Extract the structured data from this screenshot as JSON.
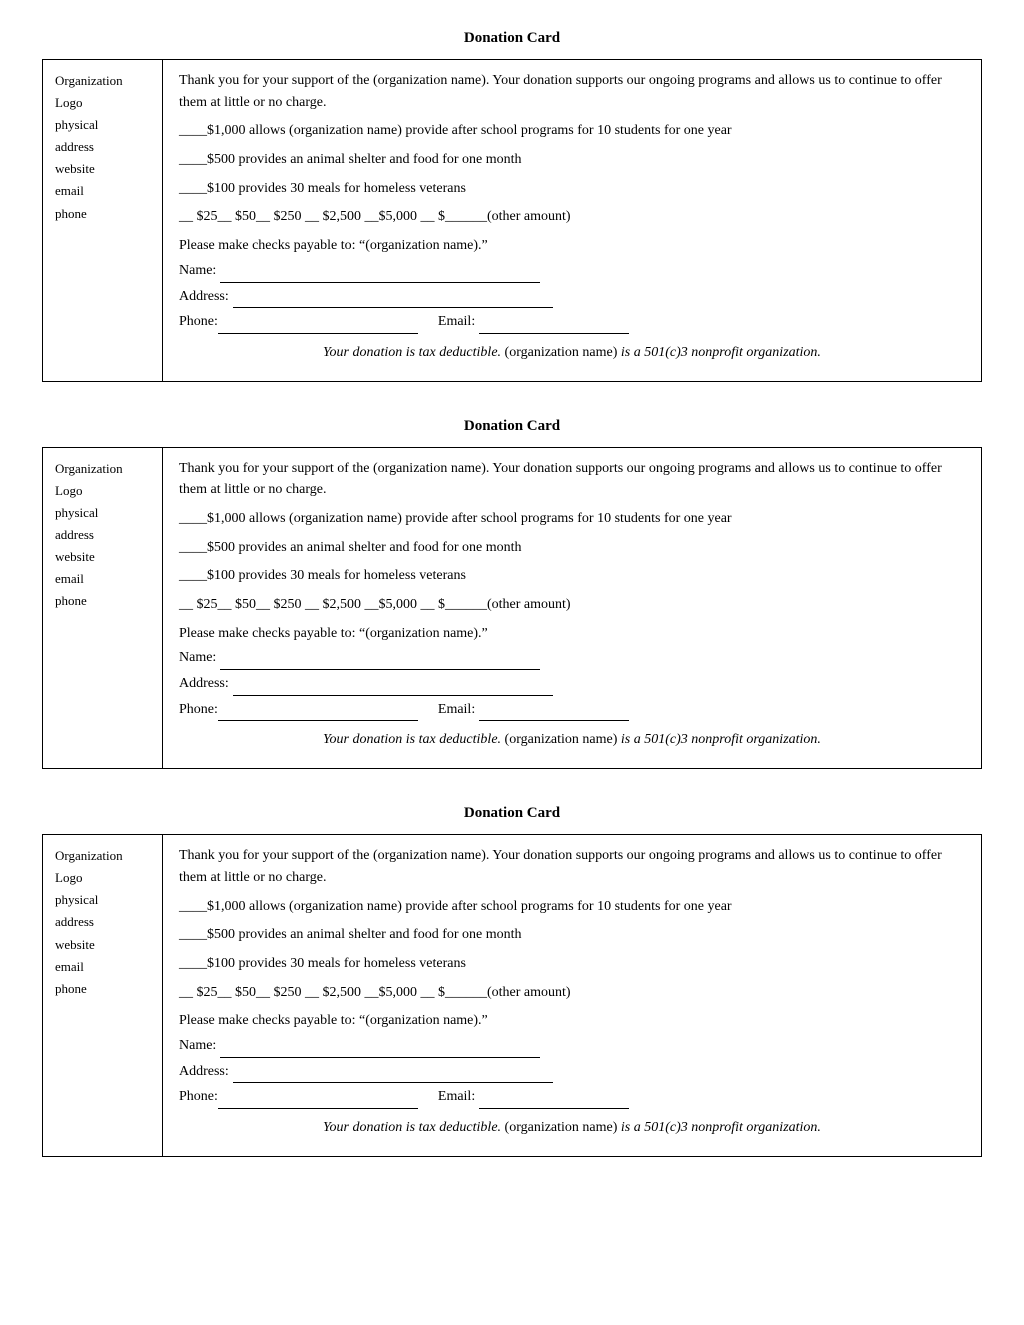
{
  "cards": [
    {
      "title": "Donation Card",
      "logo_lines": [
        "Organization",
        "Logo",
        "physical",
        "address",
        "website",
        "email",
        "phone"
      ],
      "intro": "Thank you for your support of the (organization name).  Your donation supports our ongoing programs and allows us to continue to offer them at little or no charge.",
      "donation1": "____$1,000 allows (organization name) provide after school programs for 10 students for one year",
      "donation2": "____$500 provides an animal shelter and food for one month",
      "donation3": "____$100 provides 30 meals for homeless veterans",
      "amounts": "__ $25__ $50__ $250 __ $2,500 __$5,000      __ $______(other amount)",
      "checks_payable": "Please make checks payable to: “(organization name).”",
      "name_label": "Name:",
      "address_label": "Address:",
      "phone_label": "Phone:",
      "email_label": "Email:",
      "tax_italic": "Your donation is tax deductible.",
      "tax_normal": "(organization name)",
      "tax_italic2": "is a 501(c)3 nonprofit organization."
    }
  ]
}
